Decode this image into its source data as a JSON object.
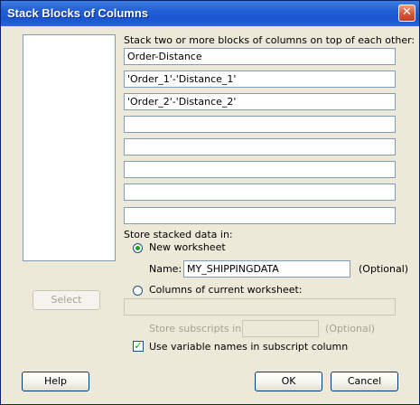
{
  "window": {
    "title": "Stack Blocks of Columns",
    "close_label": "✕"
  },
  "stack": {
    "instruction": "Stack two or more blocks of columns on top of each other:",
    "rows": [
      "Order-Distance",
      "'Order_1'-'Distance_1'",
      "'Order_2'-'Distance_2'",
      "",
      "",
      "",
      "",
      ""
    ]
  },
  "store": {
    "heading": "Store stacked data in:",
    "new_worksheet_label": "New worksheet",
    "new_worksheet_checked": true,
    "name_label": "Name:",
    "name_value": "MY_SHIPPINGDATA",
    "optional_label": "(Optional)",
    "columns_label": "Columns of current worksheet:",
    "columns_checked": false,
    "columns_value": "",
    "subscripts_label": "Store subscripts in:",
    "subscripts_value": "",
    "subscripts_optional": "(Optional)",
    "use_varnames_label": "Use variable names in subscript column",
    "use_varnames_checked": true
  },
  "buttons": {
    "select": "Select",
    "help": "Help",
    "ok": "OK",
    "cancel": "Cancel"
  },
  "icons": {
    "close": "close-icon",
    "checkmark": "checkmark-icon"
  }
}
